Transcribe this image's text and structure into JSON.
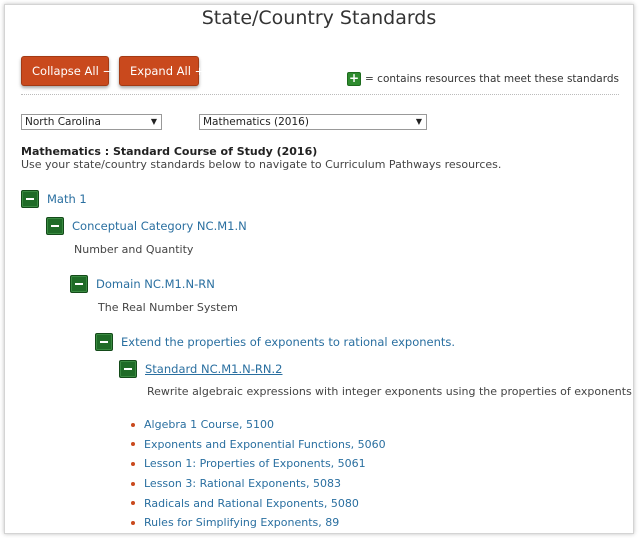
{
  "page": {
    "title": "State/Country Standards"
  },
  "toolbar": {
    "collapse_label": "Collapse All −",
    "expand_label": "Expand All +",
    "legend_icon": "+",
    "legend_text": "= contains resources that meet these standards"
  },
  "filters": {
    "state": "North Carolina",
    "subject": "Mathematics (2016)"
  },
  "course": {
    "title": "Mathematics : Standard Course of Study (2016)",
    "description": "Use your state/country standards below to navigate to Curriculum Pathways resources."
  },
  "tree": {
    "level1": {
      "label": "Math 1"
    },
    "level2": {
      "label": "Conceptual Category NC.M1.N",
      "description": "Number and Quantity"
    },
    "level3": {
      "label": "Domain NC.M1.N-RN",
      "description": "The Real Number System"
    },
    "level4": {
      "label": "Extend the properties of exponents to rational exponents."
    },
    "level5": {
      "label": "Standard NC.M1.N-RN.2",
      "description": "Rewrite algebraic expressions with integer exponents using the properties of exponents."
    }
  },
  "resources": [
    "Algebra 1 Course, 5100",
    "Exponents and Exponential Functions, 5060",
    "Lesson 1: Properties of Exponents, 5061",
    "Lesson 3: Rational Exponents, 5083",
    "Radicals and Rational Exponents, 5080",
    "Rules for Simplifying Exponents, 89"
  ],
  "colors": {
    "button": "#c9491d",
    "toggle": "#1f6b27",
    "link": "#2a6fa0",
    "legend_icon": "#2e8b2e"
  }
}
